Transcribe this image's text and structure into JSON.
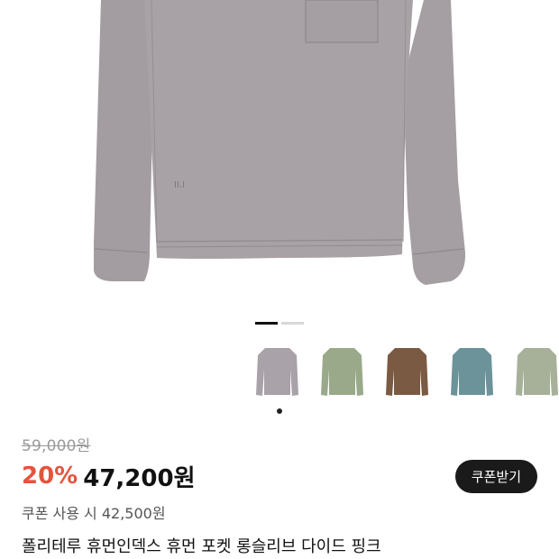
{
  "product": {
    "original_price": "59,000원",
    "discount_rate": "20%",
    "sale_price": "47,200원",
    "coupon_price": "쿠폰 사용 시 42,500원",
    "name": "폴리테루 휴먼인덱스 휴먼 포켓 롱슬리브 다이드 핑크"
  },
  "buttons": {
    "coupon": "쿠폰받기"
  },
  "gallery": {
    "total_images": 2,
    "current_index": 1
  },
  "colors": {
    "main_shirt": "#a59ea2",
    "options": [
      {
        "name": "pink",
        "hex": "#a9a2a8",
        "selected": true
      },
      {
        "name": "olive",
        "hex": "#9aa98a",
        "selected": false
      },
      {
        "name": "brown",
        "hex": "#7b5a43",
        "selected": false
      },
      {
        "name": "blue",
        "hex": "#6c939a",
        "selected": false
      },
      {
        "name": "sage",
        "hex": "#a7b19a",
        "selected": false
      }
    ],
    "discount": "#e5533d",
    "button_bg": "#1a1a1a"
  }
}
